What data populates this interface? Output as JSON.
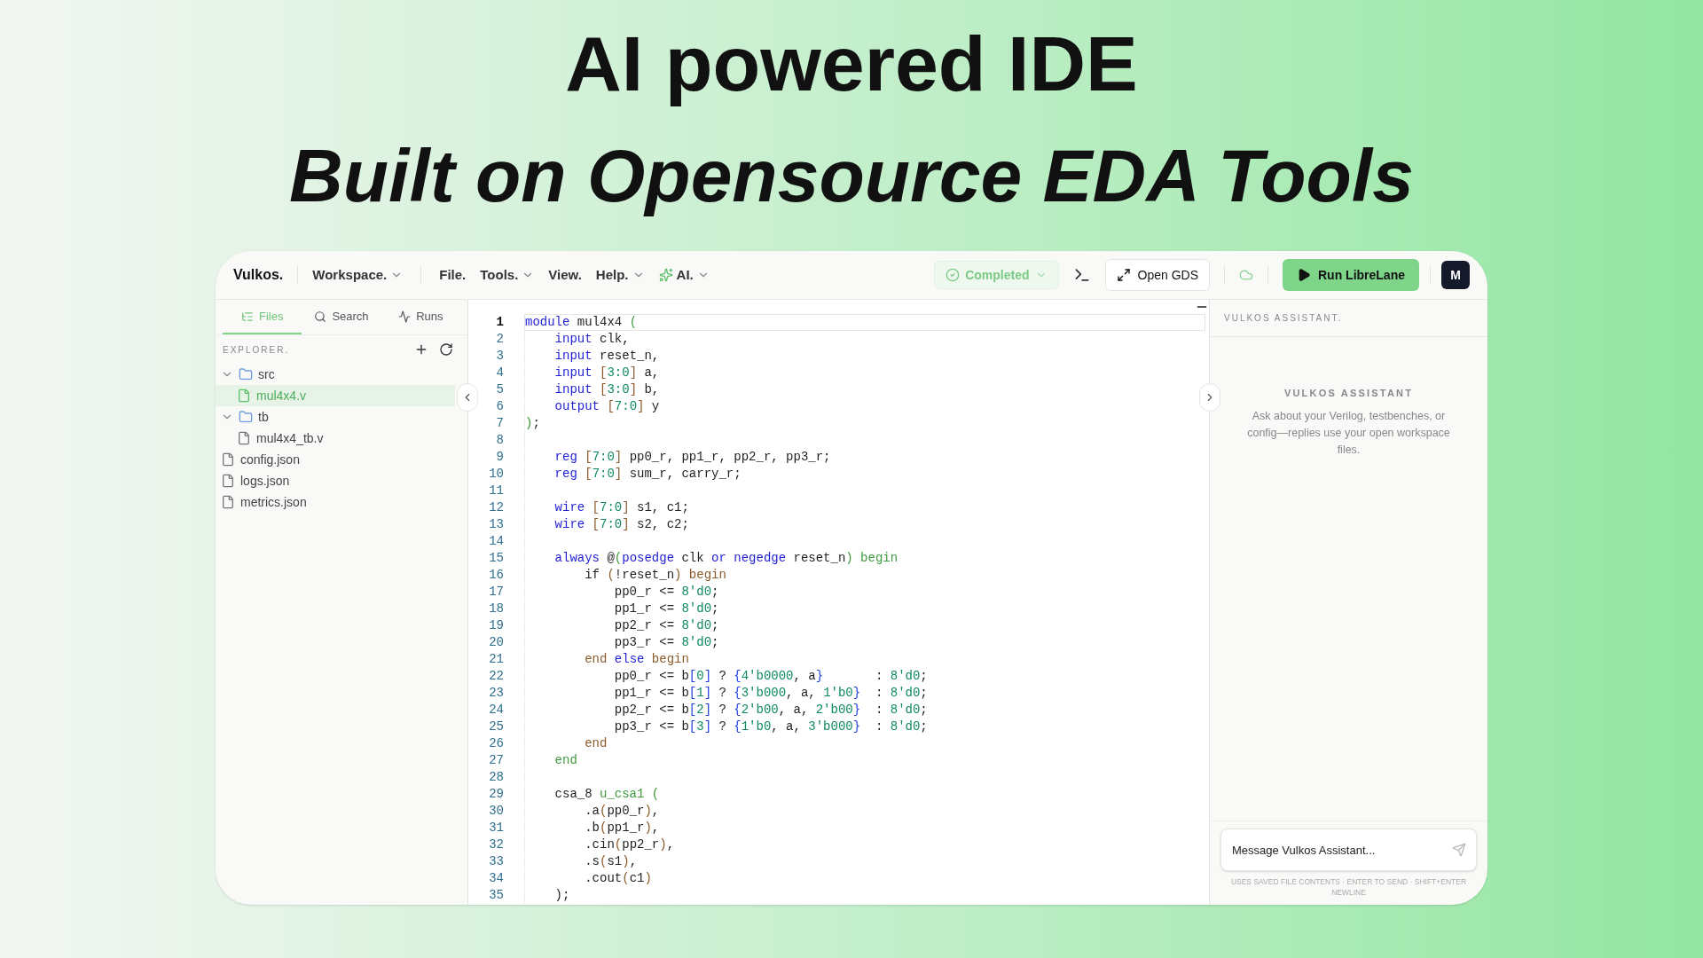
{
  "headline": {
    "title": "AI powered IDE",
    "subtitle": "Built on Opensource EDA Tools"
  },
  "topbar": {
    "brand": "Vulkos.",
    "workspace_menu": {
      "label": "Workspace.",
      "dropdown": true
    },
    "menus": [
      {
        "label": "File.",
        "dropdown": false
      },
      {
        "label": "Tools.",
        "dropdown": true
      },
      {
        "label": "View.",
        "dropdown": false
      },
      {
        "label": "Help.",
        "dropdown": true
      },
      {
        "label": "AI.",
        "dropdown": true,
        "kind": "ai"
      }
    ],
    "status": {
      "label": "Completed",
      "kind": "success"
    },
    "open_button": "Open GDS",
    "run_button": "Run LibreLane",
    "avatar": "M"
  },
  "sidebar": {
    "tabs": [
      {
        "label": "Files",
        "selected": true,
        "kind": "files"
      },
      {
        "label": "Search",
        "selected": false,
        "kind": "search"
      },
      {
        "label": "Runs",
        "selected": false,
        "kind": "runs"
      }
    ],
    "section_title": "EXPLORER.",
    "tree": [
      {
        "name": "src",
        "kind": "folder",
        "expanded": true,
        "selected": false,
        "children": [
          {
            "name": "mul4x4.v",
            "kind": "file",
            "selected": true
          }
        ]
      },
      {
        "name": "tb",
        "kind": "folder",
        "expanded": true,
        "selected": false,
        "children": [
          {
            "name": "mul4x4_tb.v",
            "kind": "file",
            "selected": false
          }
        ]
      },
      {
        "name": "config.json",
        "kind": "file",
        "selected": false
      },
      {
        "name": "logs.json",
        "kind": "file",
        "selected": false
      },
      {
        "name": "metrics.json",
        "kind": "file",
        "selected": false
      }
    ]
  },
  "editor": {
    "lines": [
      {
        "number": "1",
        "selected": true,
        "tokens": [
          {
            "text": "module",
            "kind": "kw"
          },
          {
            "text": " mul4x4 ",
            "kind": "p"
          },
          {
            "text": "(",
            "kind": "g"
          }
        ]
      },
      {
        "number": "2",
        "selected": false,
        "tokens": [
          {
            "text": "    input",
            "kind": "kw"
          },
          {
            "text": " clk,",
            "kind": "p"
          }
        ]
      },
      {
        "number": "3",
        "selected": false,
        "tokens": [
          {
            "text": "    input",
            "kind": "kw"
          },
          {
            "text": " reset_n,",
            "kind": "p"
          }
        ]
      },
      {
        "number": "4",
        "selected": false,
        "tokens": [
          {
            "text": "    input",
            "kind": "kw"
          },
          {
            "text": " [",
            "kind": "b1"
          },
          {
            "text": "3:0",
            "kind": "n"
          },
          {
            "text": "]",
            "kind": "b1"
          },
          {
            "text": " a,",
            "kind": "p"
          }
        ]
      },
      {
        "number": "5",
        "selected": false,
        "tokens": [
          {
            "text": "    input",
            "kind": "kw"
          },
          {
            "text": " [",
            "kind": "b1"
          },
          {
            "text": "3:0",
            "kind": "n"
          },
          {
            "text": "]",
            "kind": "b1"
          },
          {
            "text": " b,",
            "kind": "p"
          }
        ]
      },
      {
        "number": "6",
        "selected": false,
        "tokens": [
          {
            "text": "    output",
            "kind": "kw"
          },
          {
            "text": " [",
            "kind": "b1"
          },
          {
            "text": "7:0",
            "kind": "n"
          },
          {
            "text": "]",
            "kind": "b1"
          },
          {
            "text": " y",
            "kind": "p"
          }
        ]
      },
      {
        "number": "7",
        "selected": false,
        "tokens": [
          {
            "text": ")",
            "kind": "g"
          },
          {
            "text": ";",
            "kind": "p"
          }
        ]
      },
      {
        "number": "8",
        "selected": false
      },
      {
        "number": "9",
        "selected": false,
        "tokens": [
          {
            "text": "    reg",
            "kind": "kw"
          },
          {
            "text": " [",
            "kind": "b1"
          },
          {
            "text": "7:0",
            "kind": "n"
          },
          {
            "text": "]",
            "kind": "b1"
          },
          {
            "text": " pp0_r, pp1_r, pp2_r, pp3_r;",
            "kind": "p"
          }
        ]
      },
      {
        "number": "10",
        "selected": false,
        "tokens": [
          {
            "text": "    reg",
            "kind": "kw"
          },
          {
            "text": " [",
            "kind": "b1"
          },
          {
            "text": "7:0",
            "kind": "n"
          },
          {
            "text": "]",
            "kind": "b1"
          },
          {
            "text": " sum_r, carry_r;",
            "kind": "p"
          }
        ]
      },
      {
        "number": "11",
        "selected": false
      },
      {
        "number": "12",
        "selected": false,
        "tokens": [
          {
            "text": "    wire",
            "kind": "kw"
          },
          {
            "text": " [",
            "kind": "b1"
          },
          {
            "text": "7:0",
            "kind": "n"
          },
          {
            "text": "]",
            "kind": "b1"
          },
          {
            "text": " s1, c1;",
            "kind": "p"
          }
        ]
      },
      {
        "number": "13",
        "selected": false,
        "tokens": [
          {
            "text": "    wire",
            "kind": "kw"
          },
          {
            "text": " [",
            "kind": "b1"
          },
          {
            "text": "7:0",
            "kind": "n"
          },
          {
            "text": "]",
            "kind": "b1"
          },
          {
            "text": " s2, c2;",
            "kind": "p"
          }
        ]
      },
      {
        "number": "14",
        "selected": false
      },
      {
        "number": "15",
        "selected": false,
        "tokens": [
          {
            "text": "    always",
            "kind": "kw"
          },
          {
            "text": " @",
            "kind": "p"
          },
          {
            "text": "(",
            "kind": "g"
          },
          {
            "text": "posedge",
            "kind": "kw"
          },
          {
            "text": " clk ",
            "kind": "p"
          },
          {
            "text": "or",
            "kind": "kw"
          },
          {
            "text": " negedge",
            "kind": "kw"
          },
          {
            "text": " reset_n",
            "kind": "p"
          },
          {
            "text": ")",
            "kind": "g"
          },
          {
            "text": " begin",
            "kind": "g"
          }
        ]
      },
      {
        "number": "16",
        "selected": false,
        "tokens": [
          {
            "text": "        if ",
            "kind": "p"
          },
          {
            "text": "(",
            "kind": "b1"
          },
          {
            "text": "!reset_n",
            "kind": "p"
          },
          {
            "text": ")",
            "kind": "b1"
          },
          {
            "text": " begin",
            "kind": "b1"
          }
        ]
      },
      {
        "number": "17",
        "selected": false,
        "tokens": [
          {
            "text": "            pp0_r <= ",
            "kind": "p"
          },
          {
            "text": "8'd0",
            "kind": "n"
          },
          {
            "text": ";",
            "kind": "p"
          }
        ]
      },
      {
        "number": "18",
        "selected": false,
        "tokens": [
          {
            "text": "            pp1_r <= ",
            "kind": "p"
          },
          {
            "text": "8'd0",
            "kind": "n"
          },
          {
            "text": ";",
            "kind": "p"
          }
        ]
      },
      {
        "number": "19",
        "selected": false,
        "tokens": [
          {
            "text": "            pp2_r <= ",
            "kind": "p"
          },
          {
            "text": "8'd0",
            "kind": "n"
          },
          {
            "text": ";",
            "kind": "p"
          }
        ]
      },
      {
        "number": "20",
        "selected": false,
        "tokens": [
          {
            "text": "            pp3_r <= ",
            "kind": "p"
          },
          {
            "text": "8'd0",
            "kind": "n"
          },
          {
            "text": ";",
            "kind": "p"
          }
        ]
      },
      {
        "number": "21",
        "selected": false,
        "tokens": [
          {
            "text": "        end",
            "kind": "b1"
          },
          {
            "text": " else",
            "kind": "kw"
          },
          {
            "text": " begin",
            "kind": "b1"
          }
        ]
      },
      {
        "number": "22",
        "selected": false,
        "tokens": [
          {
            "text": "            pp0_r <= b",
            "kind": "p"
          },
          {
            "text": "[",
            "kind": "b2"
          },
          {
            "text": "0",
            "kind": "n"
          },
          {
            "text": "]",
            "kind": "b2"
          },
          {
            "text": " ? ",
            "kind": "p"
          },
          {
            "text": "{",
            "kind": "b2"
          },
          {
            "text": "4'b0000",
            "kind": "n"
          },
          {
            "text": ", a",
            "kind": "p"
          },
          {
            "text": "}",
            "kind": "b2"
          },
          {
            "text": "       : ",
            "kind": "p"
          },
          {
            "text": "8'd0",
            "kind": "n"
          },
          {
            "text": ";",
            "kind": "p"
          }
        ]
      },
      {
        "number": "23",
        "selected": false,
        "tokens": [
          {
            "text": "            pp1_r <= b",
            "kind": "p"
          },
          {
            "text": "[",
            "kind": "b2"
          },
          {
            "text": "1",
            "kind": "n"
          },
          {
            "text": "]",
            "kind": "b2"
          },
          {
            "text": " ? ",
            "kind": "p"
          },
          {
            "text": "{",
            "kind": "b2"
          },
          {
            "text": "3'b000",
            "kind": "n"
          },
          {
            "text": ", a, ",
            "kind": "p"
          },
          {
            "text": "1'b0",
            "kind": "n"
          },
          {
            "text": "}",
            "kind": "b2"
          },
          {
            "text": "  : ",
            "kind": "p"
          },
          {
            "text": "8'd0",
            "kind": "n"
          },
          {
            "text": ";",
            "kind": "p"
          }
        ]
      },
      {
        "number": "24",
        "selected": false,
        "tokens": [
          {
            "text": "            pp2_r <= b",
            "kind": "p"
          },
          {
            "text": "[",
            "kind": "b2"
          },
          {
            "text": "2",
            "kind": "n"
          },
          {
            "text": "]",
            "kind": "b2"
          },
          {
            "text": " ? ",
            "kind": "p"
          },
          {
            "text": "{",
            "kind": "b2"
          },
          {
            "text": "2'b00",
            "kind": "n"
          },
          {
            "text": ", a, ",
            "kind": "p"
          },
          {
            "text": "2'b00",
            "kind": "n"
          },
          {
            "text": "}",
            "kind": "b2"
          },
          {
            "text": "  : ",
            "kind": "p"
          },
          {
            "text": "8'd0",
            "kind": "n"
          },
          {
            "text": ";",
            "kind": "p"
          }
        ]
      },
      {
        "number": "25",
        "selected": false,
        "tokens": [
          {
            "text": "            pp3_r <= b",
            "kind": "p"
          },
          {
            "text": "[",
            "kind": "b2"
          },
          {
            "text": "3",
            "kind": "n"
          },
          {
            "text": "]",
            "kind": "b2"
          },
          {
            "text": " ? ",
            "kind": "p"
          },
          {
            "text": "{",
            "kind": "b2"
          },
          {
            "text": "1'b0",
            "kind": "n"
          },
          {
            "text": ", a, ",
            "kind": "p"
          },
          {
            "text": "3'b000",
            "kind": "n"
          },
          {
            "text": "}",
            "kind": "b2"
          },
          {
            "text": "  : ",
            "kind": "p"
          },
          {
            "text": "8'd0",
            "kind": "n"
          },
          {
            "text": ";",
            "kind": "p"
          }
        ]
      },
      {
        "number": "26",
        "selected": false,
        "tokens": [
          {
            "text": "        end",
            "kind": "b1"
          }
        ]
      },
      {
        "number": "27",
        "selected": false,
        "tokens": [
          {
            "text": "    end",
            "kind": "g"
          }
        ]
      },
      {
        "number": "28",
        "selected": false
      },
      {
        "number": "29",
        "selected": false,
        "tokens": [
          {
            "text": "    csa_8 ",
            "kind": "p"
          },
          {
            "text": "u_csa1 (",
            "kind": "g"
          }
        ]
      },
      {
        "number": "30",
        "selected": false,
        "tokens": [
          {
            "text": "        .a",
            "kind": "p"
          },
          {
            "text": "(",
            "kind": "b1"
          },
          {
            "text": "pp0_r",
            "kind": "p"
          },
          {
            "text": ")",
            "kind": "b1"
          },
          {
            "text": ",",
            "kind": "p"
          }
        ]
      },
      {
        "number": "31",
        "selected": false,
        "tokens": [
          {
            "text": "        .b",
            "kind": "p"
          },
          {
            "text": "(",
            "kind": "b1"
          },
          {
            "text": "pp1_r",
            "kind": "p"
          },
          {
            "text": ")",
            "kind": "b1"
          },
          {
            "text": ",",
            "kind": "p"
          }
        ]
      },
      {
        "number": "32",
        "selected": false,
        "tokens": [
          {
            "text": "        .cin",
            "kind": "p"
          },
          {
            "text": "(",
            "kind": "b1"
          },
          {
            "text": "pp2_r",
            "kind": "p"
          },
          {
            "text": ")",
            "kind": "b1"
          },
          {
            "text": ",",
            "kind": "p"
          }
        ]
      },
      {
        "number": "33",
        "selected": false,
        "tokens": [
          {
            "text": "        .s",
            "kind": "p"
          },
          {
            "text": "(",
            "kind": "b1"
          },
          {
            "text": "s1",
            "kind": "p"
          },
          {
            "text": ")",
            "kind": "b1"
          },
          {
            "text": ",",
            "kind": "p"
          }
        ]
      },
      {
        "number": "34",
        "selected": false,
        "tokens": [
          {
            "text": "        .cout",
            "kind": "p"
          },
          {
            "text": "(",
            "kind": "b1"
          },
          {
            "text": "c1",
            "kind": "p"
          },
          {
            "text": ")",
            "kind": "b1"
          }
        ]
      },
      {
        "number": "35",
        "selected": false,
        "tokens": [
          {
            "text": "    );",
            "kind": "p"
          }
        ]
      }
    ]
  },
  "assistant": {
    "header": "VULKOS ASSISTANT.",
    "empty_title": "VULKOS ASSISTANT",
    "empty_text": "Ask about your Verilog, testbenches, or config—replies use your open workspace files.",
    "input": {
      "placeholder": "Message Vulkos Assistant..."
    },
    "footer": "USES SAVED FILE CONTENTS · ENTER TO SEND · SHIFT+ENTER NEWLINE"
  }
}
